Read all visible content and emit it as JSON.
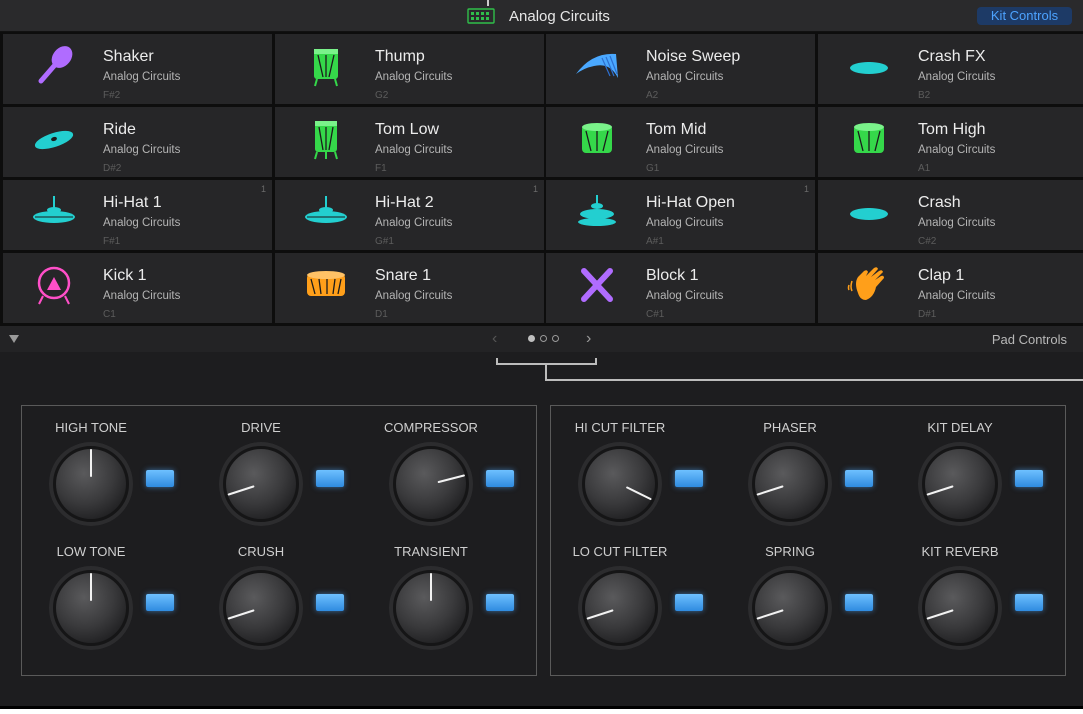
{
  "header": {
    "title": "Analog Circuits",
    "kit_controls_label": "Kit Controls"
  },
  "pads": [
    {
      "name": "Shaker",
      "kit": "Analog Circuits",
      "note": "F#2",
      "icon": "shaker-icon",
      "color": "#b06cff",
      "badge": ""
    },
    {
      "name": "Thump",
      "kit": "Analog Circuits",
      "note": "G2",
      "icon": "thump-drum-icon",
      "color": "#35d84a",
      "badge": ""
    },
    {
      "name": "Noise Sweep",
      "kit": "Analog Circuits",
      "note": "A2",
      "icon": "noise-sweep-icon",
      "color": "#4aa8ff",
      "badge": ""
    },
    {
      "name": "Crash FX",
      "kit": "Analog Circuits",
      "note": "B2",
      "icon": "cymbal-icon",
      "color": "#23cfd0",
      "badge": ""
    },
    {
      "name": "Ride",
      "kit": "Analog Circuits",
      "note": "D#2",
      "icon": "ride-cymbal-icon",
      "color": "#23cfd0",
      "badge": ""
    },
    {
      "name": "Tom Low",
      "kit": "Analog Circuits",
      "note": "F1",
      "icon": "floor-tom-icon",
      "color": "#35d84a",
      "badge": ""
    },
    {
      "name": "Tom Mid",
      "kit": "Analog Circuits",
      "note": "G1",
      "icon": "tom-icon",
      "color": "#35d84a",
      "badge": ""
    },
    {
      "name": "Tom High",
      "kit": "Analog Circuits",
      "note": "A1",
      "icon": "tom-icon",
      "color": "#35d84a",
      "badge": ""
    },
    {
      "name": "Hi-Hat 1",
      "kit": "Analog Circuits",
      "note": "F#1",
      "icon": "hihat-icon",
      "color": "#23cfd0",
      "badge": "1"
    },
    {
      "name": "Hi-Hat 2",
      "kit": "Analog Circuits",
      "note": "G#1",
      "icon": "hihat-icon",
      "color": "#23cfd0",
      "badge": "1"
    },
    {
      "name": "Hi-Hat Open",
      "kit": "Analog Circuits",
      "note": "A#1",
      "icon": "hihat-open-icon",
      "color": "#23cfd0",
      "badge": "1"
    },
    {
      "name": "Crash",
      "kit": "Analog Circuits",
      "note": "C#2",
      "icon": "cymbal-icon",
      "color": "#23cfd0",
      "badge": ""
    },
    {
      "name": "Kick 1",
      "kit": "Analog Circuits",
      "note": "C1",
      "icon": "kick-drum-icon",
      "color": "#ff4fc8",
      "badge": ""
    },
    {
      "name": "Snare 1",
      "kit": "Analog Circuits",
      "note": "D1",
      "icon": "snare-drum-icon",
      "color": "#ff9f1a",
      "badge": ""
    },
    {
      "name": "Block 1",
      "kit": "Analog Circuits",
      "note": "C#1",
      "icon": "block-icon",
      "color": "#b06cff",
      "badge": ""
    },
    {
      "name": "Clap 1",
      "kit": "Analog Circuits",
      "note": "D#1",
      "icon": "clap-hand-icon",
      "color": "#ff9f1a",
      "badge": ""
    }
  ],
  "pager": {
    "current_page": 1,
    "page_count": 3,
    "pad_controls_label": "Pad Controls"
  },
  "kit_controls": {
    "left_panel": [
      {
        "label": "HIGH TONE",
        "value": 0.5
      },
      {
        "label": "DRIVE",
        "value": 0.1
      },
      {
        "label": "COMPRESSOR",
        "value": 0.78
      },
      {
        "label": "LOW TONE",
        "value": 0.5
      },
      {
        "label": "CRUSH",
        "value": 0.1
      },
      {
        "label": "TRANSIENT",
        "value": 0.5
      }
    ],
    "right_panel": [
      {
        "label": "HI CUT FILTER",
        "value": 0.93
      },
      {
        "label": "PHASER",
        "value": 0.1
      },
      {
        "label": "KIT DELAY",
        "value": 0.1
      },
      {
        "label": "LO CUT FILTER",
        "value": 0.1
      },
      {
        "label": "SPRING",
        "value": 0.1
      },
      {
        "label": "KIT REVERB",
        "value": 0.1
      }
    ]
  },
  "colors": {
    "accent_blue": "#4da3ff",
    "led_blue": "#3d9cf0"
  }
}
